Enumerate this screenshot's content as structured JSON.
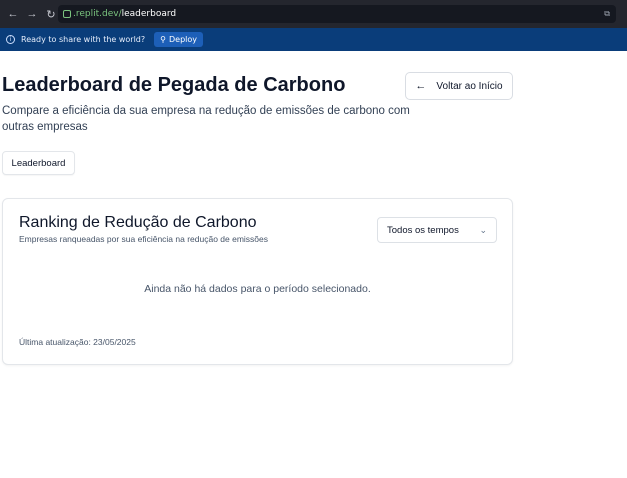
{
  "browser": {
    "url_host": ".replit.dev/",
    "url_path": "leaderboard",
    "back_glyph": "←",
    "forward_glyph": "→",
    "reload_glyph": "↻",
    "tab_glyph": "⧉"
  },
  "banner": {
    "message": "Ready to share with the world?",
    "deploy_label": "Deploy",
    "info_glyph": "i",
    "rocket_glyph": "⚲"
  },
  "page": {
    "title": "Leaderboard de Pegada de Carbono",
    "subtitle": "Compare a eficiência da sua empresa na redução de emissões de carbono com outras empresas",
    "back_label": "Voltar ao Início",
    "back_glyph": "←",
    "tab_label": "Leaderboard"
  },
  "card": {
    "title": "Ranking de Redução de Carbono",
    "description": "Empresas ranqueadas por sua eficiência na redução de emissões",
    "period_selected": "Todos os tempos",
    "chevron_glyph": "⌄",
    "empty_message": "Ainda não há dados para o período selecionado.",
    "last_updated": "Última atualização: 23/05/2025"
  }
}
